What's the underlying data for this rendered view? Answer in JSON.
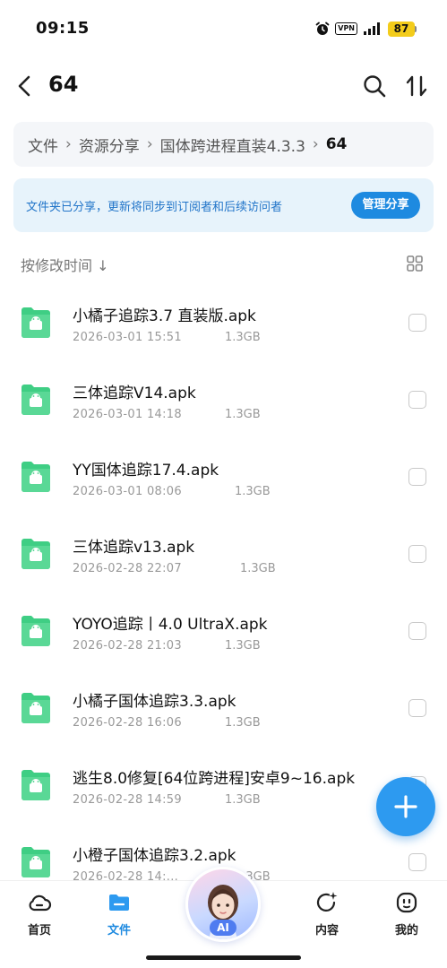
{
  "status_bar": {
    "time": "09:15",
    "vpn": "VPN",
    "battery": "87"
  },
  "header": {
    "title": "64"
  },
  "breadcrumb": {
    "items": [
      "文件",
      "资源分享",
      "国体跨进程直装4.3.3"
    ],
    "current": "64"
  },
  "share_banner": {
    "text": "文件夹已分享，更新将同步到订阅者和后续访问者",
    "button": "管理分享"
  },
  "sort": {
    "label": "按修改时间 ↓"
  },
  "files": [
    {
      "name": "小橘子追踪3.7 直装版.apk",
      "date": "2026-03-01 15:51",
      "size": "1.3GB"
    },
    {
      "name": "三体追踪V14.apk",
      "date": "2026-03-01 14:18",
      "size": "1.3GB"
    },
    {
      "name": "YY国体追踪17.4.apk",
      "date": "2026-03-01 08:06",
      "size": "1.3GB"
    },
    {
      "name": "三体追踪v13.apk",
      "date": "2026-02-28 22:07",
      "size": "1.3GB"
    },
    {
      "name": "YOYO追踪丨4.0 UltraX.apk",
      "date": "2026-02-28 21:03",
      "size": "1.3GB"
    },
    {
      "name": "小橘子国体追踪3.3.apk",
      "date": "2026-02-28 16:06",
      "size": "1.3GB"
    },
    {
      "name": "逃生8.0修复[64位跨进程]安卓9~16.apk",
      "date": "2026-02-28 14:59",
      "size": "1.3GB"
    },
    {
      "name": "小橙子国体追踪3.2.apk",
      "date": "2026-02-28 14:...",
      "size": "1.3GB"
    }
  ],
  "nav": {
    "home": "首页",
    "files": "文件",
    "ai": "AI",
    "content": "内容",
    "mine": "我的"
  },
  "colors": {
    "accent": "#1e8ae0",
    "folder": "#3fce84",
    "battery": "#f3cc1b"
  }
}
